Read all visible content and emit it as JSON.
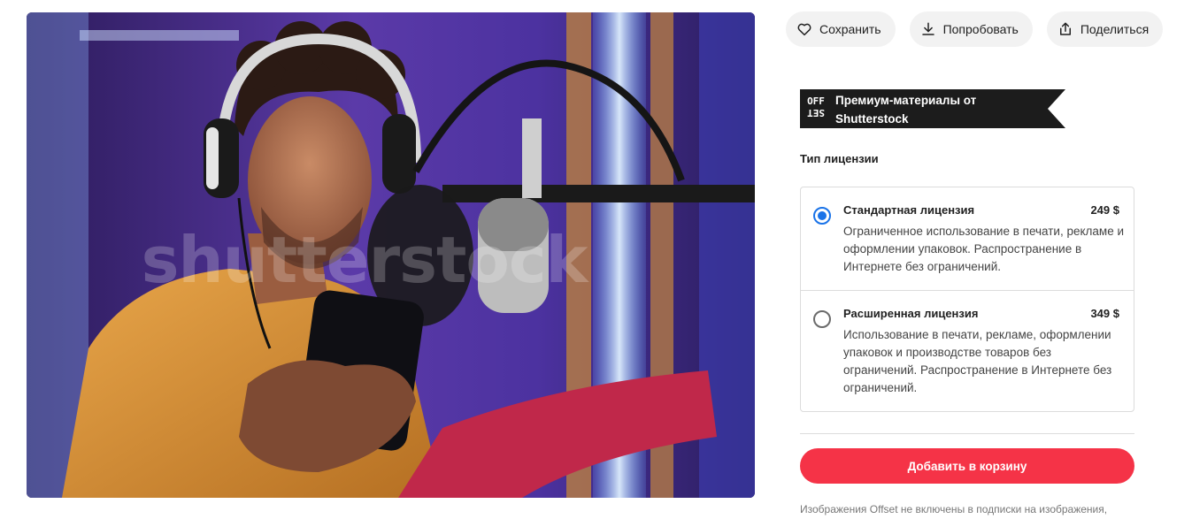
{
  "photo": {
    "watermark": "shutterstock",
    "alt_icon": "studio-singer-photo"
  },
  "actions": {
    "save_label": "Сохранить",
    "try_label": "Попробовать",
    "share_label": "Поделиться"
  },
  "banner": {
    "logo_top": "OFF",
    "logo_bottom": "SET",
    "text": "Премиум-материалы от Shutterstock"
  },
  "license": {
    "heading": "Тип лицензии",
    "options": [
      {
        "title": "Стандартная лицензия",
        "price": "249 $",
        "description": "Ограниченное использование в печати, рекламе и оформлении упаковок. Распространение в Интернете без ограничений.",
        "selected": true
      },
      {
        "title": "Расширенная лицензия",
        "price": "349 $",
        "description": "Использование в печати, рекламе, оформлении упаковок и производстве товаров без ограничений. Распространение в Интернете без ограничений.",
        "selected": false
      }
    ]
  },
  "cart": {
    "label": "Добавить в корзину"
  },
  "footnote": "Изображения Offset не включены в подписки на изображения,",
  "colors": {
    "accent_red": "#f53347",
    "radio_blue": "#1a73e8",
    "banner_black": "#1c1c1c"
  }
}
